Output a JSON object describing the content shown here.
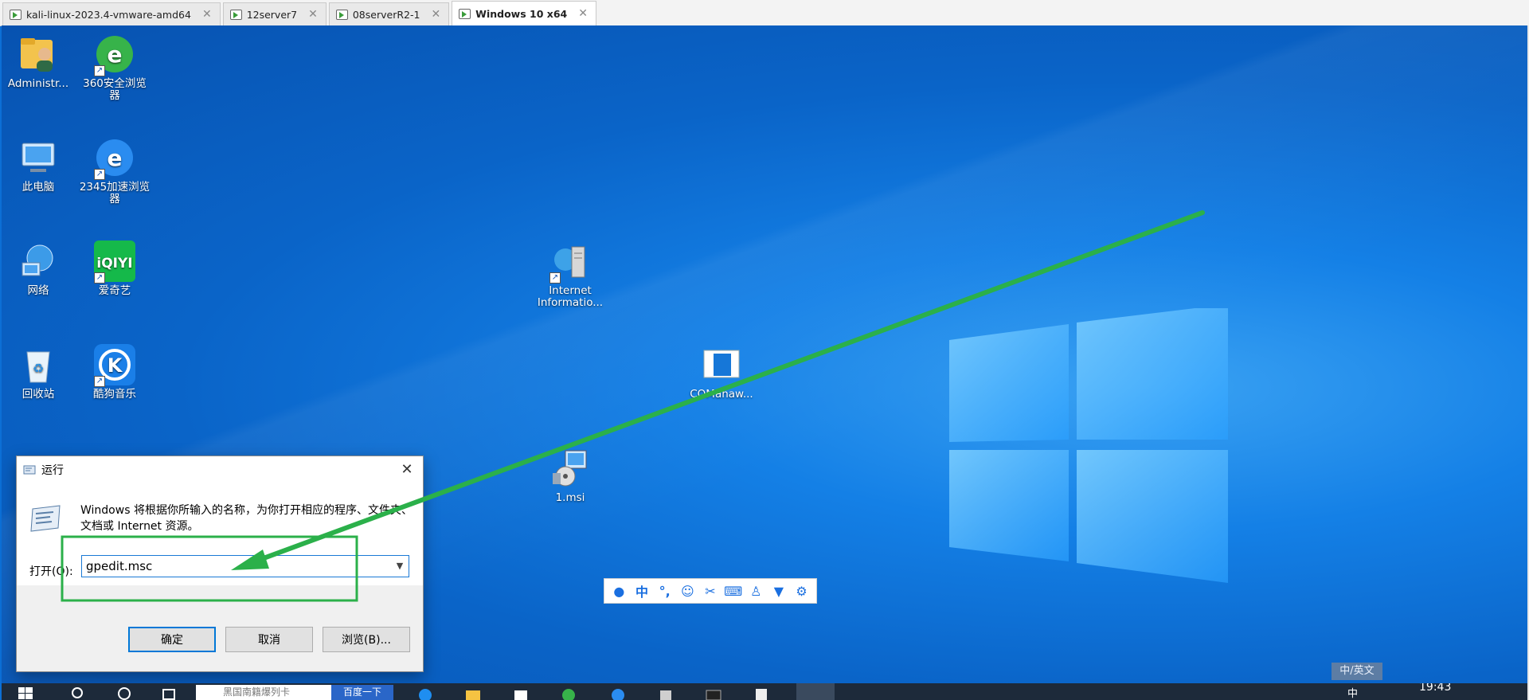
{
  "vm_tabs": [
    {
      "label": "kali-linux-2023.4-vmware-amd64",
      "active": false
    },
    {
      "label": "12server7",
      "active": false
    },
    {
      "label": "08serverR2-1",
      "active": false
    },
    {
      "label": "Windows 10 x64",
      "active": true
    }
  ],
  "desktop_icons": [
    {
      "label": "Administr...",
      "icon": "user-folder-icon"
    },
    {
      "label": "360安全浏览器",
      "icon": "360-browser-icon"
    },
    {
      "label": "此电脑",
      "icon": "computer-icon"
    },
    {
      "label": "2345加速浏览器",
      "icon": "2345-browser-icon"
    },
    {
      "label": "网络",
      "icon": "network-icon"
    },
    {
      "label": "爱奇艺",
      "icon": "iqiyi-icon"
    },
    {
      "label": "回收站",
      "icon": "recycle-bin-icon"
    },
    {
      "label": "酷狗音乐",
      "icon": "kugou-icon"
    },
    {
      "label": "Internet Informatio...",
      "icon": "iis-icon"
    },
    {
      "label": "COMahaw...",
      "icon": "document-icon"
    },
    {
      "label": "1.msi",
      "icon": "msi-installer-icon"
    }
  ],
  "run_dialog": {
    "title": "运行",
    "description": "Windows 将根据你所输入的名称，为你打开相应的程序、文件夹、文档或 Internet 资源。",
    "open_label": "打开(O):",
    "input_value": "gpedit.msc",
    "ok_label": "确定",
    "cancel_label": "取消",
    "browse_label": "浏览(B)..."
  },
  "ime_toolbar": {
    "mode_label": "中"
  },
  "lang_indicator": "中/英文",
  "taskbar": {
    "search_placeholder": "黑国南籍爆列卡",
    "search_button": "百度一下",
    "ime": "中",
    "time": "19:43"
  },
  "colors": {
    "annotation_green": "#2bb04a",
    "desktop_blue": "#0c6fd6",
    "accent": "#0078d7"
  }
}
